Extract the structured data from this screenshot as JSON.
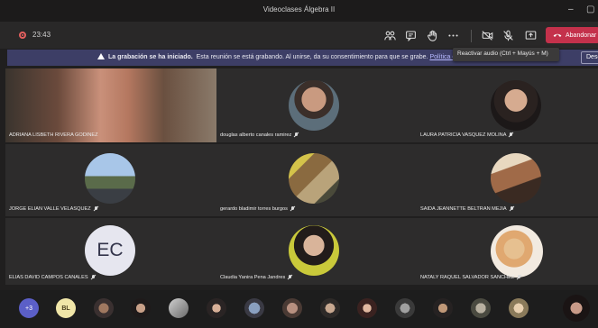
{
  "window": {
    "title": "Videoclases Álgebra II"
  },
  "toolbar": {
    "timer": "23:43",
    "leave_label": "Abandonar"
  },
  "tooltip": {
    "text": "Reactivar audio (Ctrl + Mayús + M)"
  },
  "banner": {
    "bold": "La grabación se ha iniciado.",
    "text": "Esta reunión se está grabando. Al unirse, da su consentimiento para que se grabe.",
    "link": "Política de pr",
    "dismiss": "Descar"
  },
  "participants": [
    {
      "name": "ADRIANA LISBETH RIVERA GODINEZ"
    },
    {
      "name": "douglas alberto canales ramirez"
    },
    {
      "name": "LAURA PATRICIA VASQUEZ MOLINA"
    },
    {
      "name": "JORGE ELIAN VALLE VELASQUEZ"
    },
    {
      "name": "gerardo bladimir torres burgos"
    },
    {
      "name": "SAIDA JEANNETTE BELTRAN MEJIA"
    },
    {
      "name": "ELIAS DAVID CAMPOS CANALES",
      "initials": "EC"
    },
    {
      "name": "Claudia Yanira Pena Jandres"
    },
    {
      "name": "NATALY RAQUEL SALVADOR SANCHEZ"
    }
  ],
  "strip": {
    "more_label": "+3",
    "bl_initials": "BL"
  },
  "colors": {
    "accent": "#5b5fc7",
    "leave": "#c4314b",
    "banner": "#3d3e66",
    "background": "#201f1f"
  }
}
